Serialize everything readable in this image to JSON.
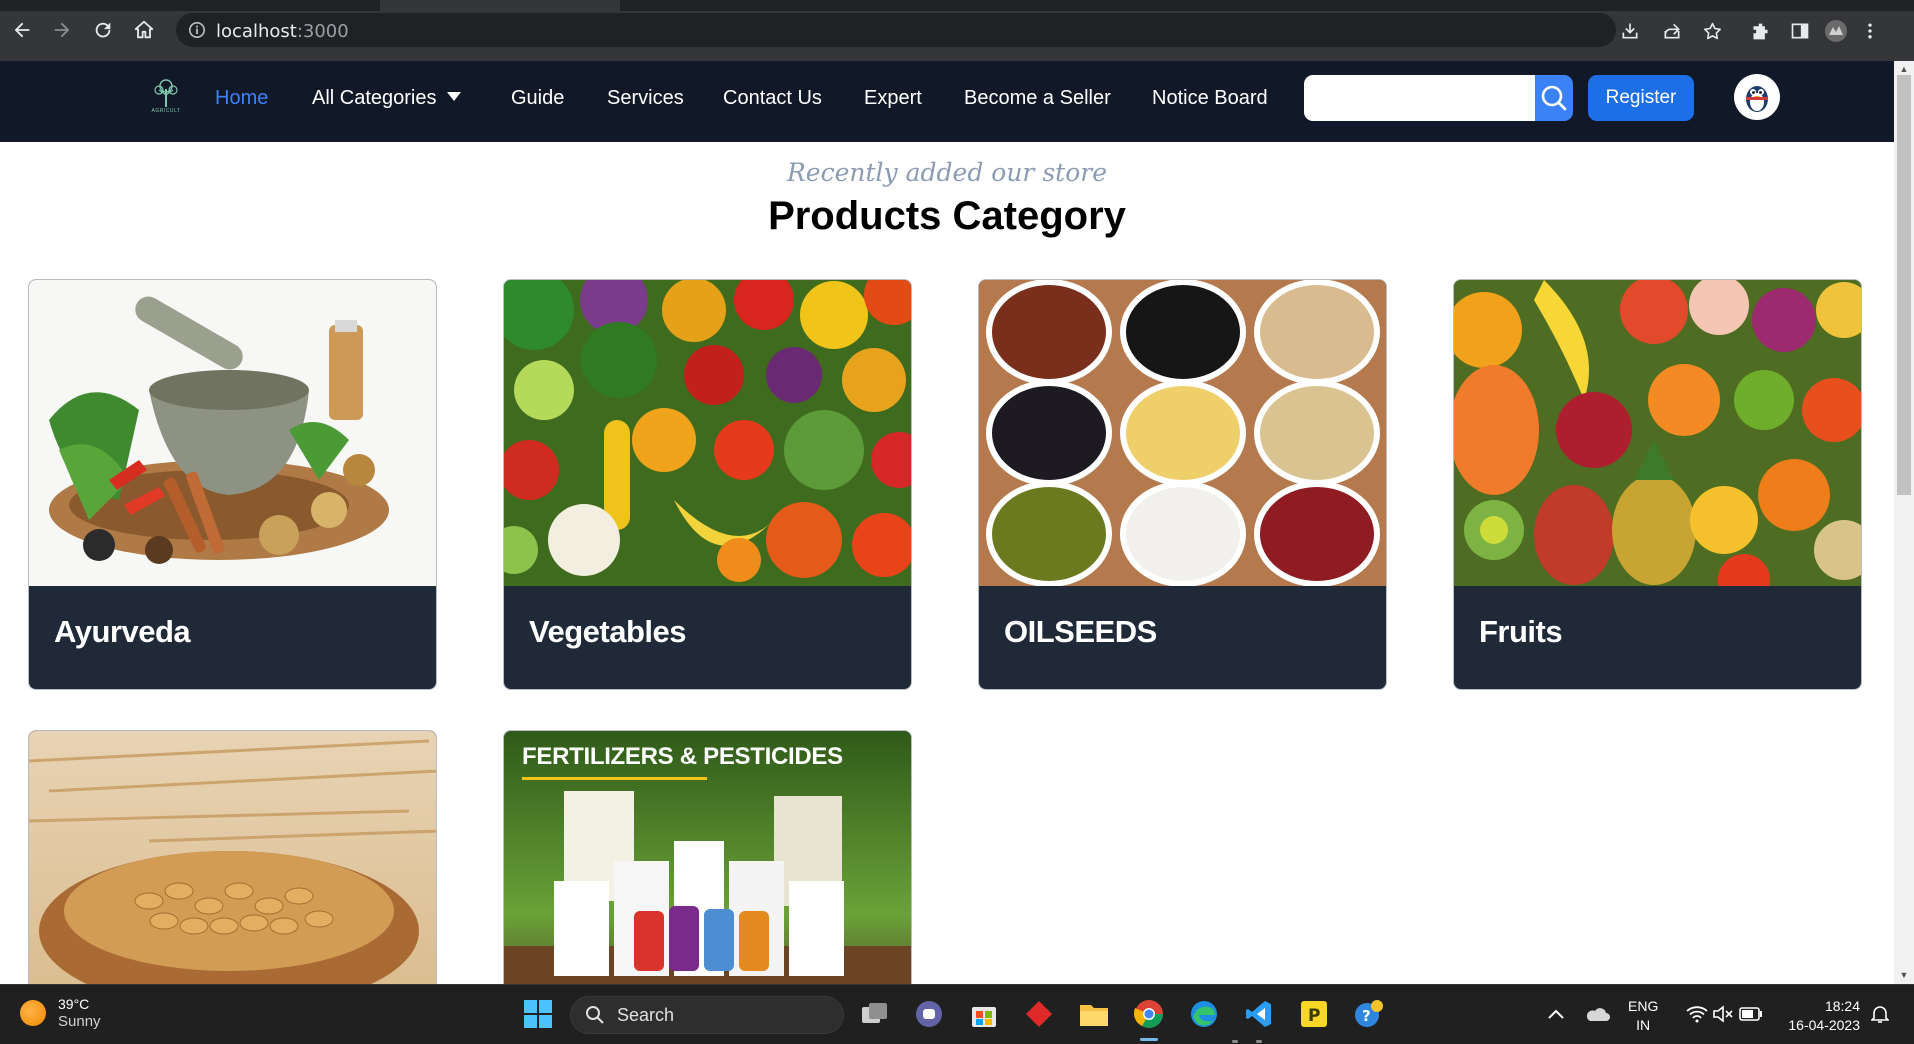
{
  "browser": {
    "url_host": "localhost",
    "url_port": ":3000"
  },
  "header": {
    "logo_text": "AGRICULT",
    "nav": {
      "home": "Home",
      "all_categories": "All Categories",
      "guide": "Guide",
      "services": "Services",
      "contact": "Contact Us",
      "expert": "Expert",
      "become_seller": "Become a Seller",
      "notice_board": "Notice Board"
    },
    "search_placeholder": "",
    "register_label": "Register"
  },
  "section": {
    "eyebrow": "Recently added our store",
    "title": "Products Category"
  },
  "categories": [
    {
      "label": "Ayurveda"
    },
    {
      "label": "Vegetables"
    },
    {
      "label": "OILSEEDS"
    },
    {
      "label": "Fruits"
    },
    {
      "label": ""
    },
    {
      "label": "",
      "banner": "FERTILIZERS & PESTICIDES"
    }
  ],
  "taskbar": {
    "temperature": "39°C",
    "condition": "Sunny",
    "search_label": "Search",
    "lang_1": "ENG",
    "lang_2": "IN",
    "time": "18:24",
    "date": "16-04-2023"
  },
  "colors": {
    "nav_bg": "#111827",
    "accent": "#3b82f6",
    "card_footer": "#1f2937"
  }
}
